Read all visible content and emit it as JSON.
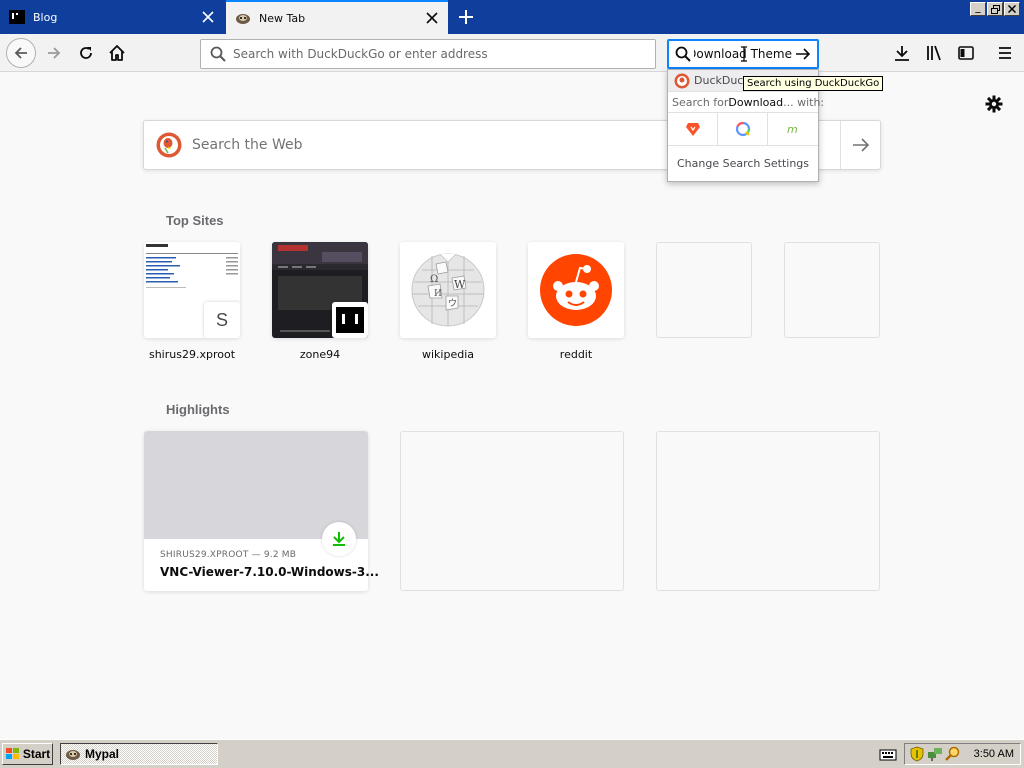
{
  "tabs": [
    {
      "title": "Blog",
      "active": false
    },
    {
      "title": "New Tab",
      "active": true
    }
  ],
  "toolbar": {
    "url_placeholder": "Search with DuckDuckGo or enter address",
    "search_value": "Download Theme"
  },
  "search_popup": {
    "engine_name": "DuckDuckGo",
    "search_for_prefix": "Search for ",
    "search_term": "Download",
    "search_for_suffix": " ... with:",
    "engines": [
      "brave-icon",
      "qwant-icon",
      "mojeek-icon"
    ],
    "change_settings": "Change Search Settings"
  },
  "tooltip": "Search using DuckDuckGo",
  "newtab": {
    "web_search_placeholder": "Search the Web",
    "topsites_title": "Top Sites",
    "top_sites": [
      {
        "label": "shirus29.xproot",
        "badge": "S"
      },
      {
        "label": "zone94"
      },
      {
        "label": "wikipedia"
      },
      {
        "label": "reddit"
      },
      {
        "label": ""
      },
      {
        "label": ""
      }
    ],
    "highlights_title": "Highlights",
    "highlights": [
      {
        "meta": "SHIRUS29.XPROOT — 9.2 MB",
        "title": "VNC-Viewer-7.10.0-Windows-3..."
      }
    ]
  },
  "taskbar": {
    "start_label": "Start",
    "task_label": "Mypal",
    "clock": "3:50 AM"
  },
  "colors": {
    "tabstrip": "#0f3e9c",
    "accent": "#0a84ff",
    "reddit": "#ff4500",
    "ddg": "#de5833",
    "download_green": "#12bc00"
  }
}
